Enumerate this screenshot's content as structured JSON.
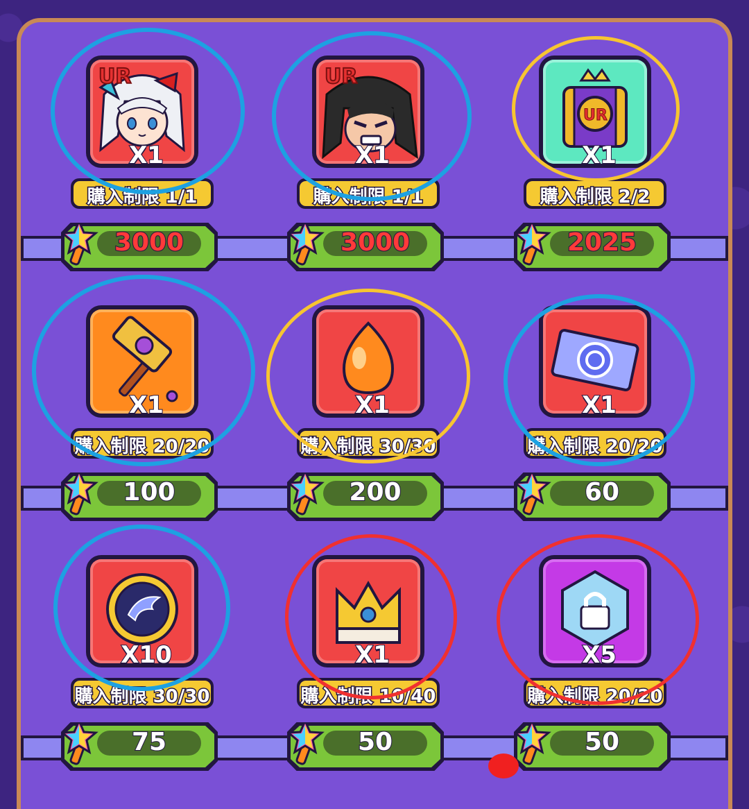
{
  "shop": {
    "items": [
      {
        "name": "UR character (white hair)",
        "icon": "ur-character-girl-icon",
        "qty": "X1",
        "limit": "購入制限 1/1",
        "price": "3000",
        "price_color": "#ff3a3a"
      },
      {
        "name": "UR character (black hair)",
        "icon": "ur-character-warrior-icon",
        "qty": "X1",
        "limit": "購入制限 1/1",
        "price": "3000",
        "price_color": "#ff3a3a"
      },
      {
        "name": "UR chest",
        "icon": "ur-treasure-chest-icon",
        "qty": "X1",
        "limit": "購入制限 2/2",
        "price": "2025",
        "price_color": "#ff3a3a"
      },
      {
        "name": "Hammer",
        "icon": "golden-hammer-icon",
        "qty": "X1",
        "limit": "購入制限 20/20",
        "price": "100",
        "price_color": "#ffffff"
      },
      {
        "name": "Orange drop",
        "icon": "orange-essence-drop-icon",
        "qty": "X1",
        "limit": "購入制限 30/30",
        "price": "200",
        "price_color": "#ffffff"
      },
      {
        "name": "Summon ticket",
        "icon": "swirl-ticket-icon",
        "qty": "X1",
        "limit": "購入制限 20/20",
        "price": "60",
        "price_color": "#ffffff"
      },
      {
        "name": "Wing token",
        "icon": "wing-medal-icon",
        "qty": "X10",
        "limit": "購入制限 30/30",
        "price": "75",
        "price_color": "#ffffff"
      },
      {
        "name": "Crown",
        "icon": "crown-icon",
        "qty": "X1",
        "limit": "購入制限 10/40",
        "price": "50",
        "price_color": "#ffffff"
      },
      {
        "name": "Lock hexagon",
        "icon": "lock-hexagon-icon",
        "qty": "X5",
        "limit": "購入制限 20/20",
        "price": "50",
        "price_color": "#ffffff"
      }
    ],
    "currency_icon": "rainbow-star-wand-icon"
  },
  "colors": {
    "background": "#3d2480",
    "panel": "#7a50d6",
    "panel_border": "#c98956",
    "price_green": "#7cc63a",
    "limit_yellow": "#f5c932"
  }
}
